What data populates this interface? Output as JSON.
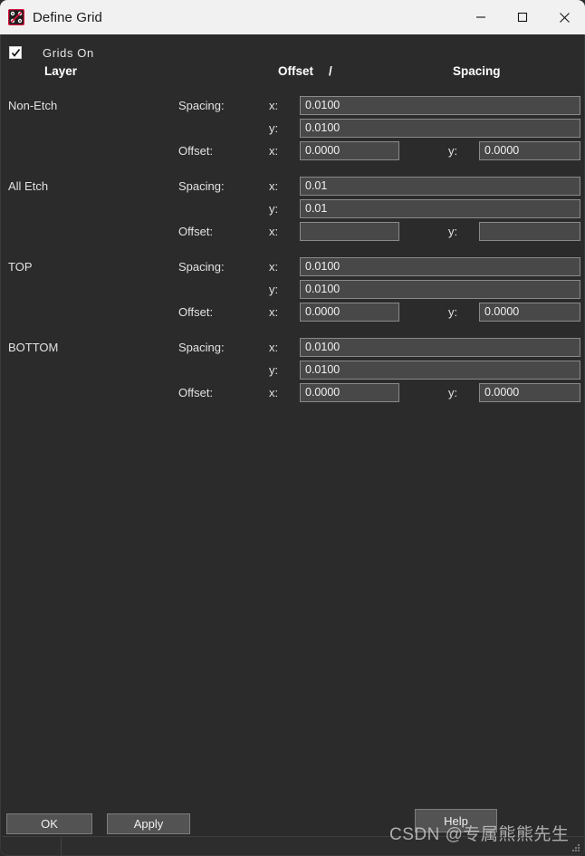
{
  "window": {
    "title": "Define Grid",
    "icon": "grid-app-icon",
    "controls": {
      "minimize": "minimize-icon",
      "maximize": "maximize-icon",
      "close": "close-icon"
    }
  },
  "options": {
    "grids_on_label": "Grids On",
    "grids_on_checked": true
  },
  "headers": {
    "layer": "Layer",
    "offset": "Offset",
    "separator": "/",
    "spacing": "Spacing"
  },
  "labels": {
    "spacing": "Spacing:",
    "offset": "Offset:",
    "x": "x:",
    "y": "y:"
  },
  "layers": [
    {
      "name": "Non-Etch",
      "spacing_x": "0.0100",
      "spacing_y": "0.0100",
      "offset_x": "0.0000",
      "offset_y": "0.0000"
    },
    {
      "name": "All Etch",
      "spacing_x": "0.01",
      "spacing_y": "0.01",
      "offset_x": "",
      "offset_y": ""
    },
    {
      "name": "TOP",
      "spacing_x": "0.0100",
      "spacing_y": "0.0100",
      "offset_x": "0.0000",
      "offset_y": "0.0000"
    },
    {
      "name": "BOTTOM",
      "spacing_x": "0.0100",
      "spacing_y": "0.0100",
      "offset_x": "0.0000",
      "offset_y": "0.0000"
    }
  ],
  "footer": {
    "ok": "OK",
    "apply": "Apply",
    "help": "Help"
  },
  "watermark": "CSDN @专属熊熊先生",
  "colors": {
    "titlebar_bg": "#f1f1f1",
    "dialog_bg": "#2b2b2b",
    "field_bg": "#484848",
    "field_border": "#8a8a8a",
    "button_bg": "#535353",
    "text": "#e2e2e2",
    "accent_red": "#d4143c"
  }
}
